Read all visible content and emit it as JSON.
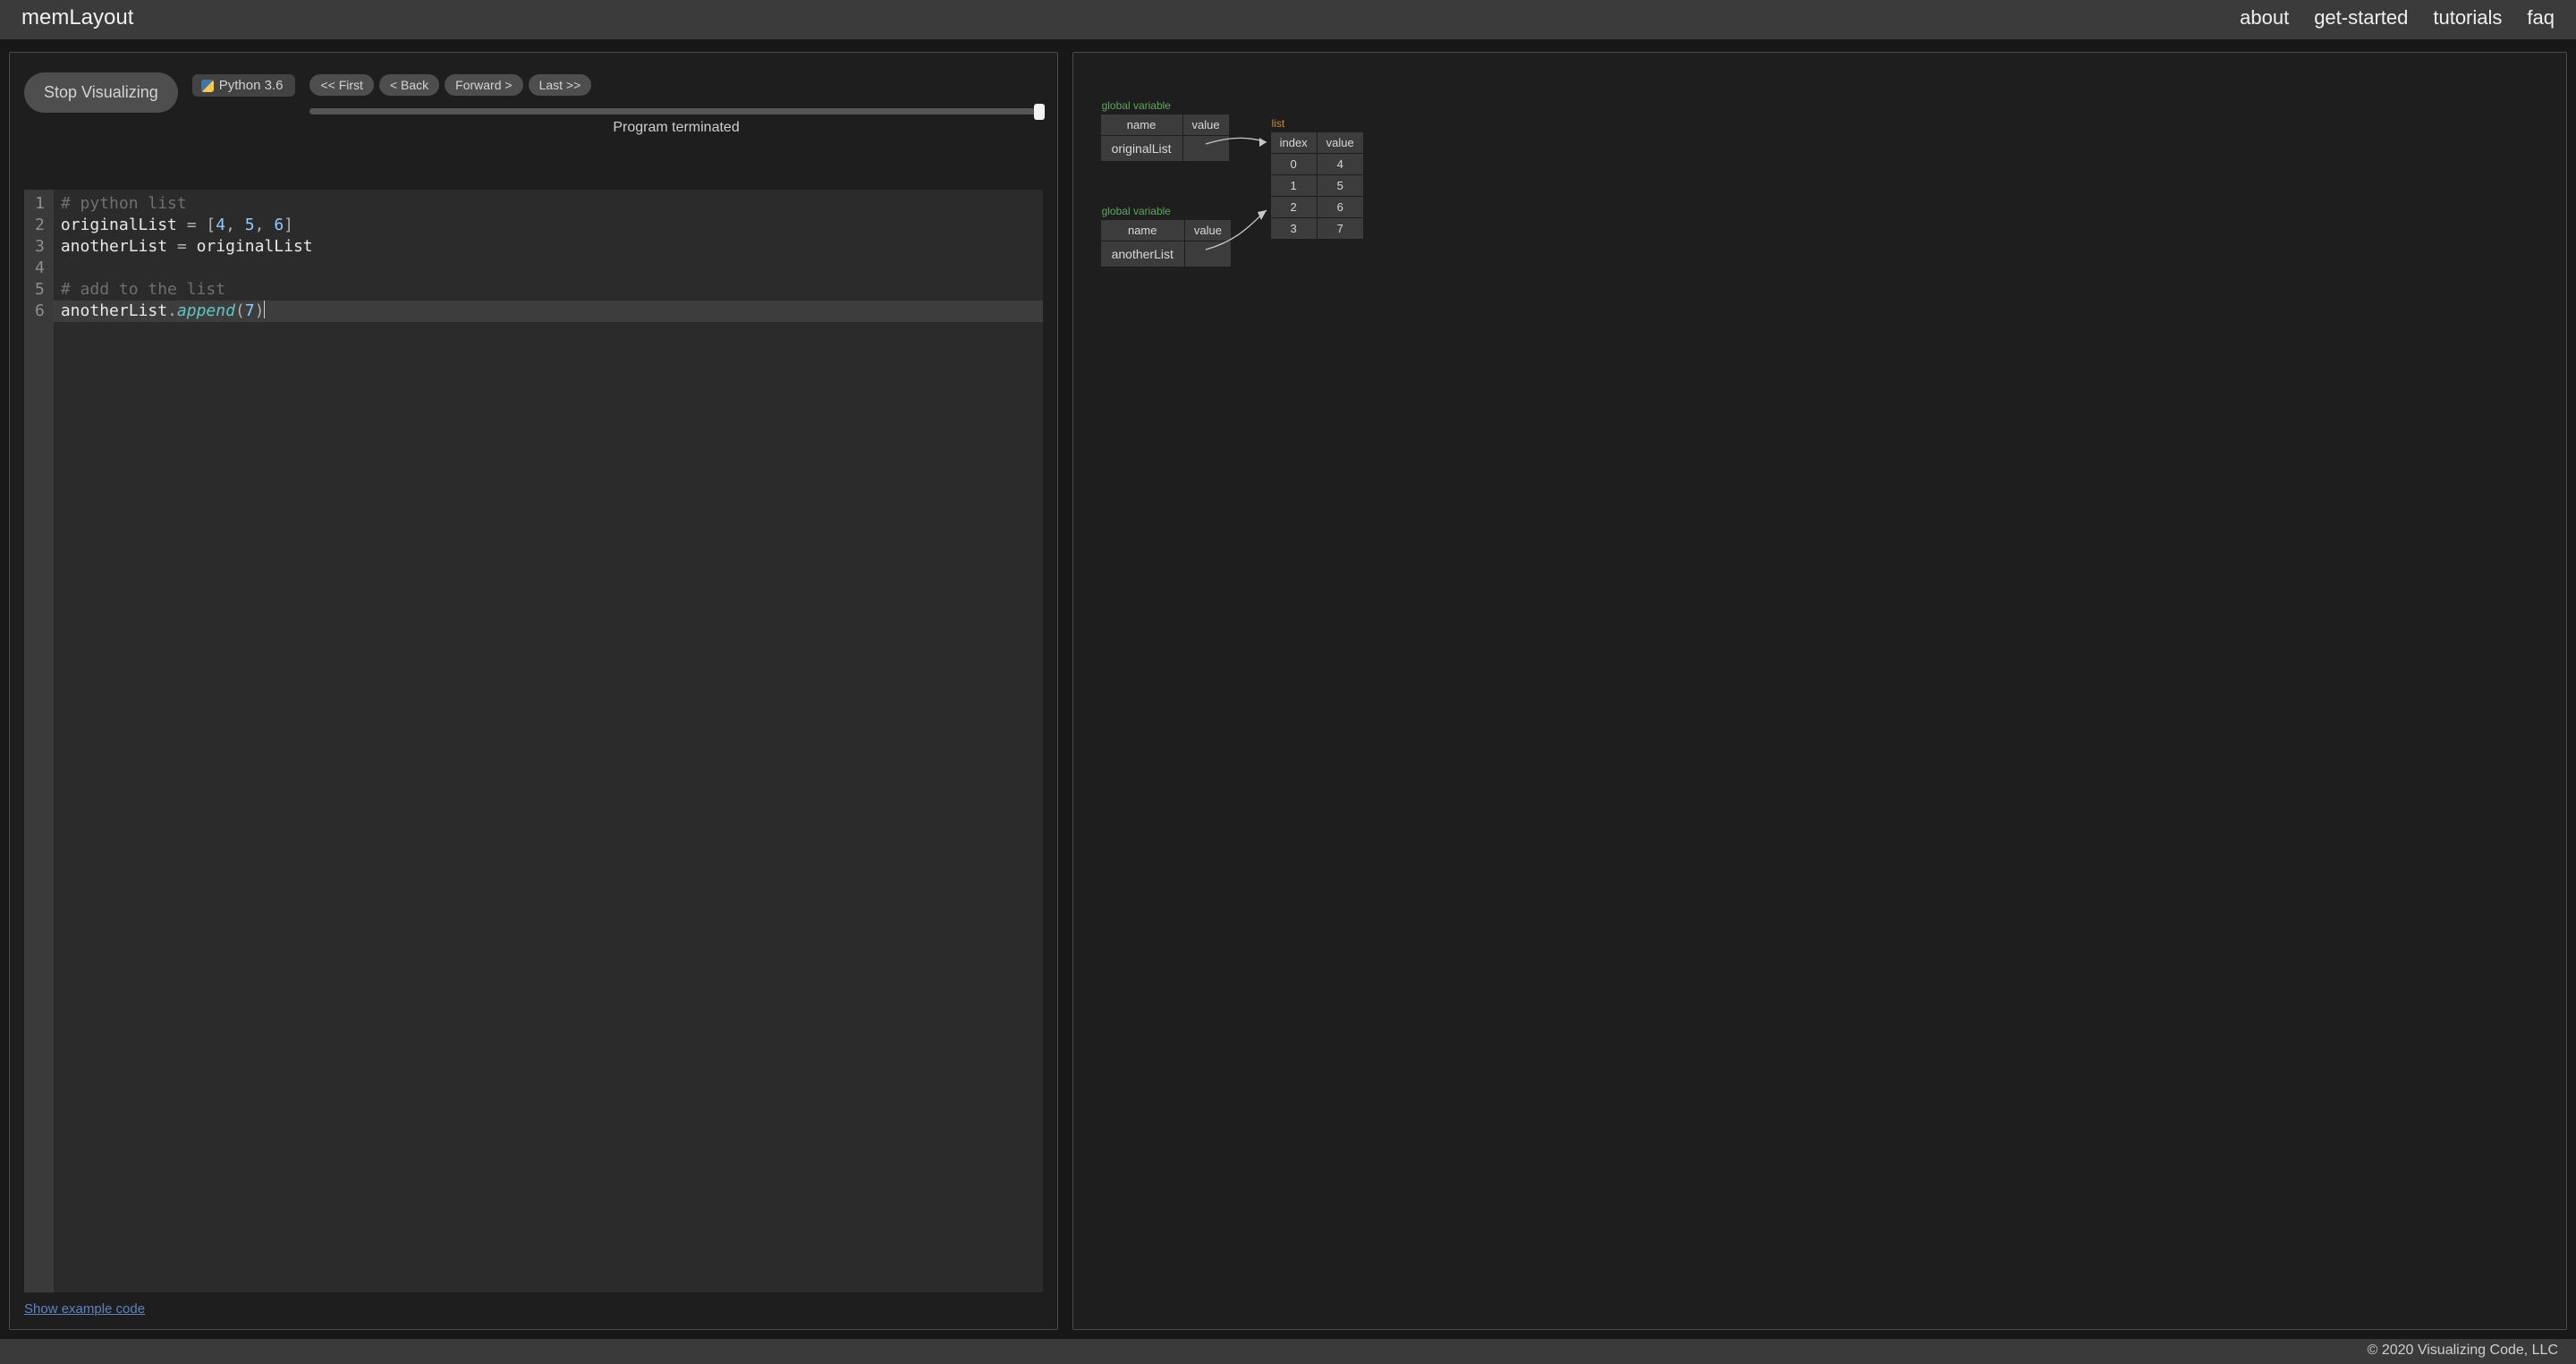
{
  "header": {
    "brand": "memLayout",
    "nav": {
      "about": "about",
      "getStarted": "get-started",
      "tutorials": "tutorials",
      "faq": "faq"
    }
  },
  "controls": {
    "stop": "Stop Visualizing",
    "language": "Python 3.6",
    "first": "<< First",
    "back": "< Back",
    "forward": "Forward >",
    "last": "Last >>",
    "status": "Program terminated"
  },
  "editor": {
    "lines": {
      "1": {
        "type": "comment",
        "text": "# python list"
      },
      "2": {
        "lhs": "originalList",
        "op": "=",
        "rhs_nums": [
          "4",
          "5",
          "6"
        ]
      },
      "3": {
        "lhs": "anotherList",
        "op": "=",
        "rhs_ident": "originalList"
      },
      "4": {
        "type": "blank"
      },
      "5": {
        "type": "comment",
        "text": "# add to the list"
      },
      "6": {
        "obj": "anotherList",
        "method": "append",
        "arg": "7"
      }
    },
    "exampleLink": "Show example code"
  },
  "memory": {
    "gvLabel": "global variable",
    "listLabel": "list",
    "headers": {
      "name": "name",
      "value": "value",
      "index": "index"
    },
    "vars": [
      {
        "name": "originalList"
      },
      {
        "name": "anotherList"
      }
    ],
    "list": [
      {
        "index": "0",
        "value": "4"
      },
      {
        "index": "1",
        "value": "5"
      },
      {
        "index": "2",
        "value": "6"
      },
      {
        "index": "3",
        "value": "7"
      }
    ]
  },
  "footer": {
    "copyright": "© 2020 Visualizing Code, LLC"
  }
}
